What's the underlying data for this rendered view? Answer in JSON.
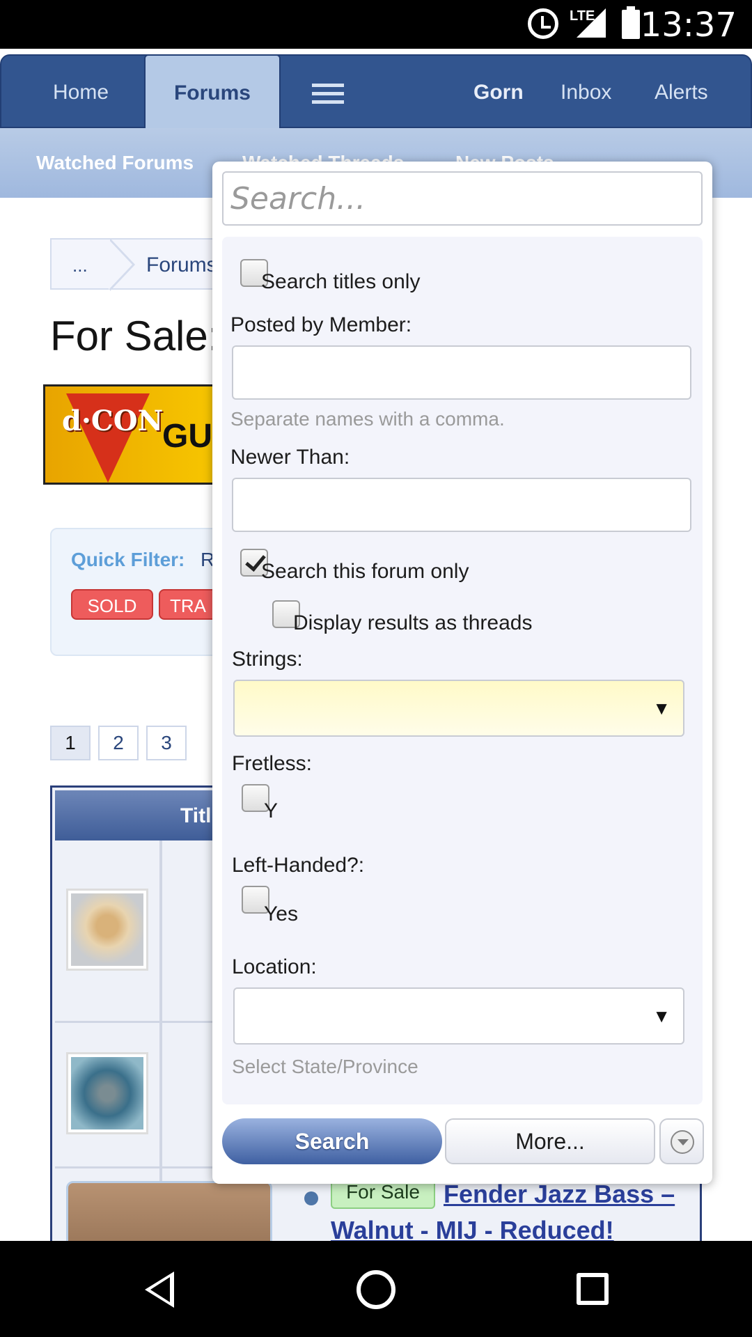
{
  "status_bar": {
    "time": "13:37",
    "network": "LTE"
  },
  "nav": {
    "home": "Home",
    "forums": "Forums",
    "user": "Gorn",
    "inbox": "Inbox",
    "alerts": "Alerts"
  },
  "subnav": {
    "watched_forums": "Watched Forums",
    "watched_threads": "Watched Threads",
    "new_posts": "New Posts"
  },
  "page": {
    "breadcrumb_more": "...",
    "breadcrumb_forums": "Forums",
    "title": "For Sale:",
    "quick_filter_label": "Quick Filter:",
    "quick_filter_first": "R",
    "tag_sold": "SOLD",
    "tag_trade": "TRA",
    "pages": [
      "1",
      "2",
      "3"
    ],
    "table_header": "Titl",
    "row3_badge": "For Sale",
    "row3_title": "Fender Jazz Bass – Walnut - MIJ - Reduced!"
  },
  "search_popup": {
    "search_placeholder": "Search...",
    "search_titles_only": "Search titles only",
    "posted_by_label": "Posted by Member:",
    "posted_by_hint": "Separate names with a comma.",
    "newer_than_label": "Newer Than:",
    "search_forum_only": "Search this forum only",
    "display_as_threads": "Display results as threads",
    "strings_label": "Strings:",
    "fretless_label": "Fretless:",
    "fretless_option": "Y",
    "left_handed_label": "Left-Handed?:",
    "left_handed_option": "Yes",
    "location_label": "Location:",
    "location_hint": "Select State/Province",
    "search_button": "Search",
    "more_button": "More...",
    "checkbox_state": {
      "search_titles_only": false,
      "search_forum_only": true,
      "display_as_threads": false,
      "fretless": false,
      "left_handed": false
    }
  },
  "icons": {
    "alarm": "alarm-icon",
    "signal": "signal-icon",
    "battery": "battery-icon",
    "menu": "hamburger-menu-icon",
    "back": "back-icon",
    "home": "home-icon",
    "recents": "recents-icon"
  }
}
